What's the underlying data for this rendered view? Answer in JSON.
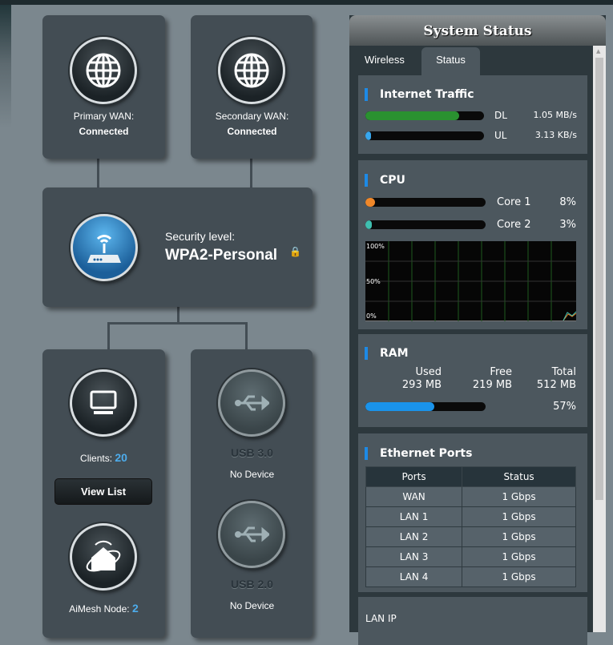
{
  "network_map": {
    "primary_wan": {
      "label": "Primary WAN:",
      "status": "Connected",
      "icon": "globe-icon"
    },
    "secondary_wan": {
      "label": "Secondary WAN:",
      "status": "Connected",
      "icon": "globe-icon"
    },
    "router": {
      "security_label": "Security level:",
      "security_value": "WPA2-Personal",
      "icon": "router-icon"
    },
    "clients": {
      "label": "Clients:",
      "count": "20",
      "button": "View List"
    },
    "aimesh": {
      "label": "AiMesh Node:",
      "count": "2"
    },
    "usb3": {
      "label": "USB 3.0",
      "status": "No Device"
    },
    "usb2": {
      "label": "USB 2.0",
      "status": "No Device"
    }
  },
  "system_status": {
    "title": "System Status",
    "tabs": [
      {
        "label": "Wireless"
      },
      {
        "label": "Status",
        "active": true
      }
    ],
    "internet_traffic": {
      "title": "Internet Traffic",
      "dl_label": "DL",
      "dl_value": "1.05 MB/s",
      "dl_fill": 0.79,
      "ul_label": "UL",
      "ul_value": "3.13 KB/s",
      "ul_fill": 0.03
    },
    "cpu": {
      "title": "CPU",
      "cores": [
        {
          "label": "Core 1",
          "value": "8%",
          "fill": 0.08,
          "color": "#f0882a"
        },
        {
          "label": "Core 2",
          "value": "3%",
          "fill": 0.03,
          "color": "#3fbfb0"
        }
      ],
      "graph_labels": [
        "100%",
        "50%",
        "0%"
      ]
    },
    "ram": {
      "title": "RAM",
      "used_label": "Used",
      "used": "293 MB",
      "free_label": "Free",
      "free": "219 MB",
      "total_label": "Total",
      "total": "512 MB",
      "percent": "57%",
      "fill": 0.57
    },
    "ethernet": {
      "title": "Ethernet Ports",
      "headers": [
        "Ports",
        "Status"
      ],
      "rows": [
        [
          "WAN",
          "1 Gbps"
        ],
        [
          "LAN 1",
          "1 Gbps"
        ],
        [
          "LAN 2",
          "1 Gbps"
        ],
        [
          "LAN 3",
          "1 Gbps"
        ],
        [
          "LAN 4",
          "1 Gbps"
        ]
      ]
    },
    "lan_ip": {
      "label": "LAN IP"
    }
  }
}
